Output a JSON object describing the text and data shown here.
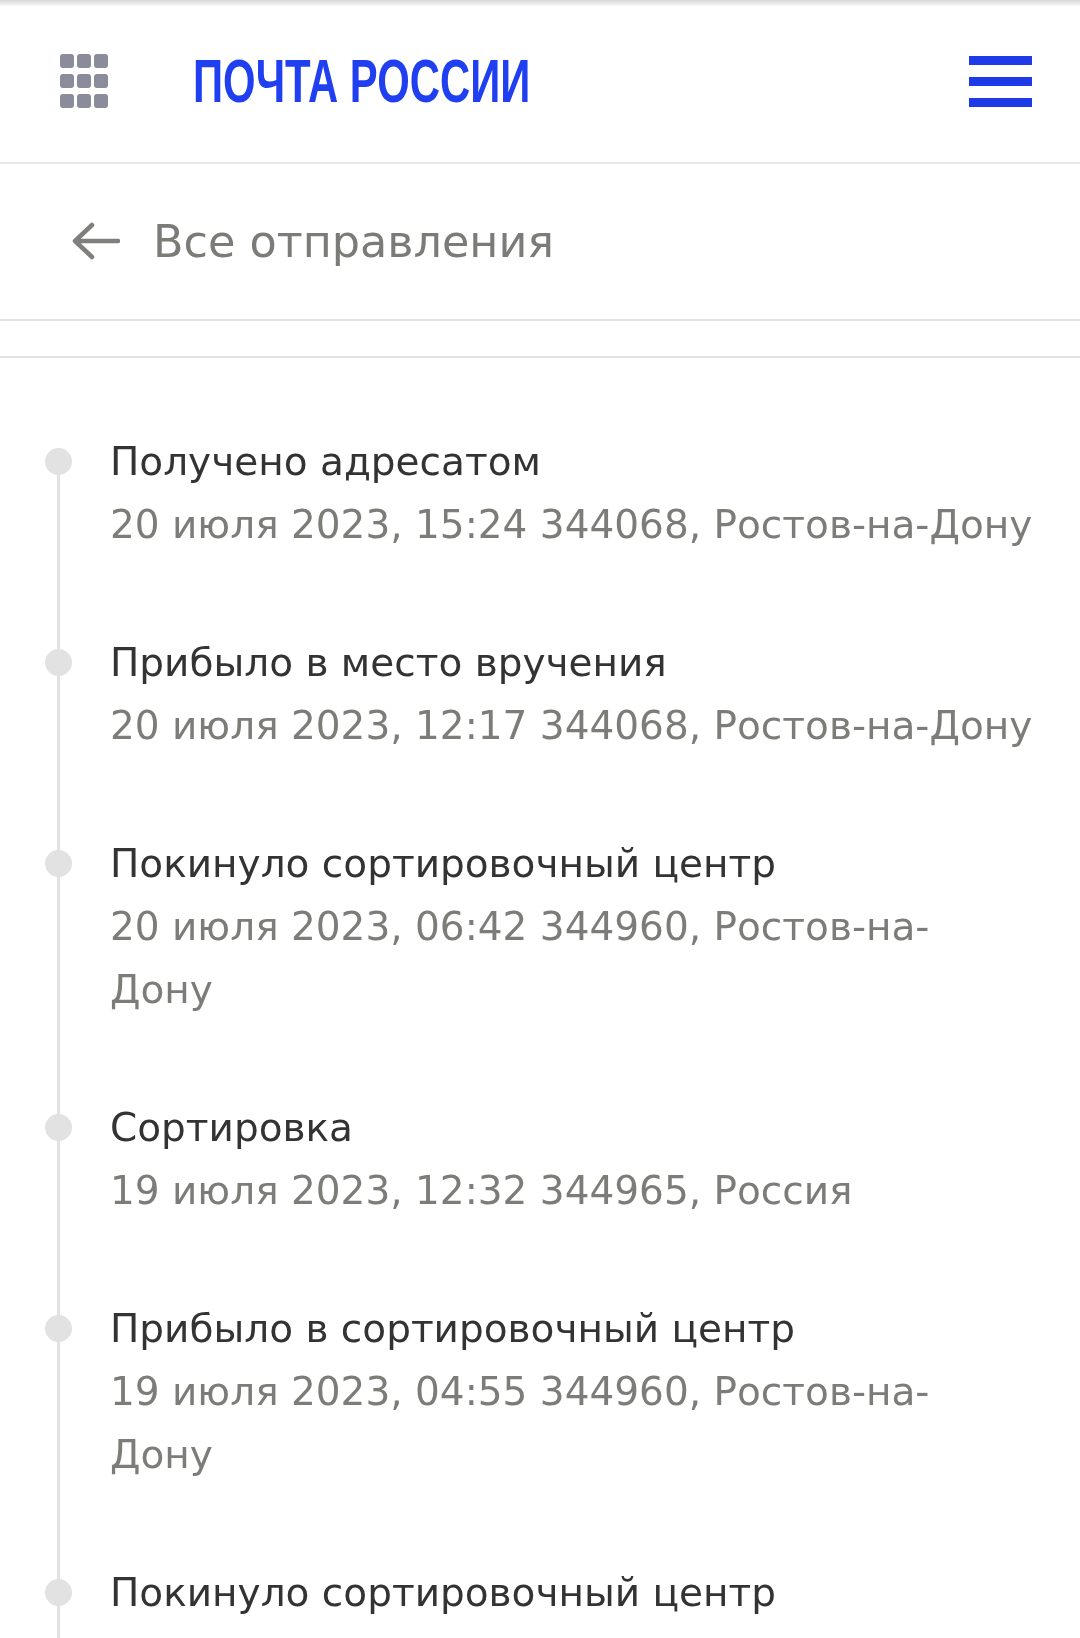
{
  "header": {
    "logo": "ПОЧТА РОССИИ"
  },
  "back_link": {
    "label": "Все отправления"
  },
  "tracking_events": [
    {
      "status": "Получено адресатом",
      "details": "20 июля 2023, 15:24 344068, Ростов-на-Дону"
    },
    {
      "status": "Прибыло в место вручения",
      "details": "20 июля 2023, 12:17 344068, Ростов-на-Дону"
    },
    {
      "status": "Покинуло сортировочный центр",
      "details": "20 июля 2023, 06:42 344960, Ростов-на-Дону"
    },
    {
      "status": "Сортировка",
      "details": "19 июля 2023, 12:32 344965, Россия"
    },
    {
      "status": "Прибыло в сортировочный центр",
      "details": "19 июля 2023, 04:55 344960, Ростов-на-Дону"
    },
    {
      "status": "Покинуло сортировочный центр"
    }
  ]
}
